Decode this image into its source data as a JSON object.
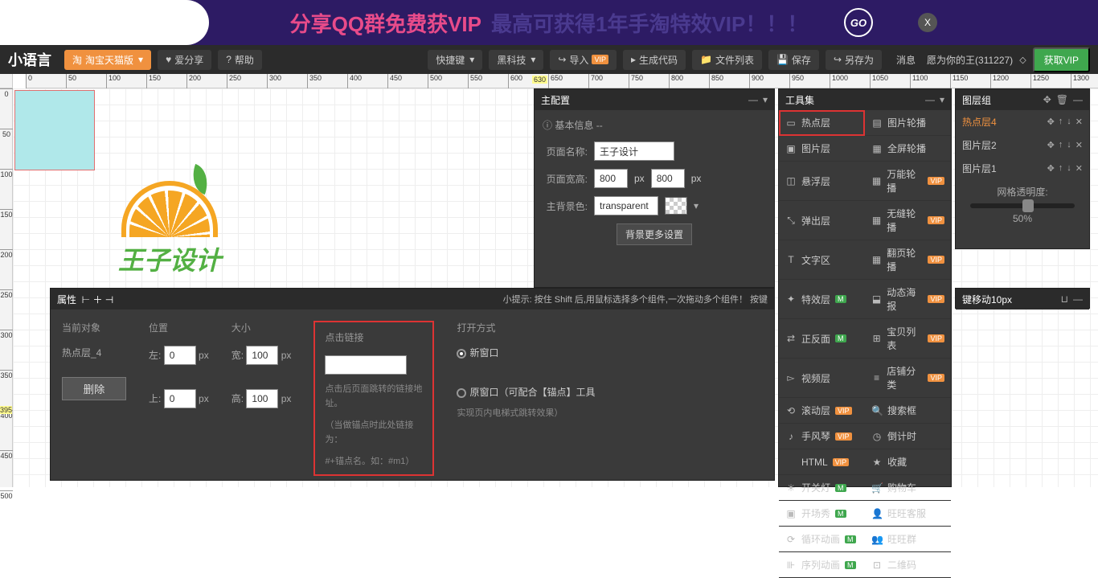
{
  "banner": {
    "text1": "分享QQ群免费获VIP",
    "text2": "最高可获得1年手淘特效VIP！！！",
    "go": "GO",
    "close": "X"
  },
  "toolbar": {
    "logo": "小语言",
    "edition": "淘宝天猫版",
    "share": "爱分享",
    "help": "帮助",
    "shortcut": "快捷键",
    "blacktech": "黑科技",
    "import": "导入",
    "gencode": "生成代码",
    "filelist": "文件列表",
    "save": "保存",
    "saveas": "另存为",
    "msg": "消息",
    "user": "愿为你的王(311227)",
    "getvip": "获取VIP",
    "vip_tag": "VIP"
  },
  "ruler": {
    "hl_h": "630",
    "hl_v": "395"
  },
  "canvas_logo": "王子设计",
  "mainConfig": {
    "title": "主配置",
    "basicInfo": "基本信息 --",
    "pageName_lbl": "页面名称:",
    "pageName_val": "王子设计",
    "pageSize_lbl": "页面宽高:",
    "w": "800",
    "h": "800",
    "px": "px",
    "bg_lbl": "主背景色:",
    "bg_val": "transparent",
    "bg_more": "背景更多设置"
  },
  "toolset": {
    "title": "工具集",
    "items": [
      {
        "icon": "▭",
        "name": "热点层",
        "hl": true
      },
      {
        "icon": "▤",
        "name": "图片轮播"
      },
      {
        "icon": "▣",
        "name": "图片层"
      },
      {
        "icon": "▦",
        "name": "全屏轮播"
      },
      {
        "icon": "◫",
        "name": "悬浮层"
      },
      {
        "icon": "▦",
        "name": "万能轮播",
        "tag": "vip"
      },
      {
        "icon": "⤡",
        "name": "弹出层"
      },
      {
        "icon": "▦",
        "name": "无缝轮播",
        "tag": "vip"
      },
      {
        "icon": "T",
        "name": "文字区"
      },
      {
        "icon": "▦",
        "name": "翻页轮播",
        "tag": "vip"
      },
      {
        "icon": "✦",
        "name": "特效层",
        "tag": "m"
      },
      {
        "icon": "⬓",
        "name": "动态海报",
        "tag": "vip"
      },
      {
        "icon": "⇄",
        "name": "正反面",
        "tag": "m"
      },
      {
        "icon": "⊞",
        "name": "宝贝列表",
        "tag": "vip"
      },
      {
        "icon": "▻",
        "name": "视频层"
      },
      {
        "icon": "≡",
        "name": "店铺分类",
        "tag": "vip"
      },
      {
        "icon": "⟲",
        "name": "滚动层",
        "tag": "vip"
      },
      {
        "icon": "🔍",
        "name": "搜索框"
      },
      {
        "icon": "♪",
        "name": "手风琴",
        "tag": "vip"
      },
      {
        "icon": "◷",
        "name": "倒计时"
      },
      {
        "icon": "</>",
        "name": "HTML",
        "tag": "vip"
      },
      {
        "icon": "★",
        "name": "收藏"
      },
      {
        "icon": "☀",
        "name": "开关灯",
        "tag": "m"
      },
      {
        "icon": "🛒",
        "name": "购物车"
      },
      {
        "icon": "▣",
        "name": "开场秀",
        "tag": "m"
      },
      {
        "icon": "👤",
        "name": "旺旺客服"
      },
      {
        "icon": "⟳",
        "name": "循环动画",
        "tag": "m"
      },
      {
        "icon": "👥",
        "name": "旺旺群"
      },
      {
        "icon": "⊪",
        "name": "序列动画",
        "tag": "m"
      },
      {
        "icon": "⊡",
        "name": "二维码"
      }
    ]
  },
  "layers": {
    "title": "图层组",
    "items": [
      {
        "name": "热点层4",
        "active": true
      },
      {
        "name": "图片层2"
      },
      {
        "name": "图片层1"
      }
    ],
    "opacity_lbl": "网格透明度:",
    "opacity_val": "50%"
  },
  "moveHint": {
    "text": "键移动10px"
  },
  "props": {
    "title": "属性",
    "hint": "小提示: 按住 Shift 后,用鼠标选择多个组件,一次拖动多个组件！  按键",
    "currentObj_lbl": "当前对象",
    "currentObj_val": "热点层_4",
    "delete": "删除",
    "pos_lbl": "位置",
    "left_lbl": "左:",
    "left_val": "0",
    "top_lbl": "上:",
    "top_val": "0",
    "size_lbl": "大小",
    "w_lbl": "宽:",
    "w_val": "100",
    "h_lbl": "高:",
    "h_val": "100",
    "px": "px",
    "link_lbl": "点击链接",
    "link_val": "",
    "link_note1": "点击后页面跳转的链接地址。",
    "link_note2": "（当做锚点时此处链接为：",
    "link_note3": "#+锚点名。如：#m1）",
    "open_lbl": "打开方式",
    "open_new": "新窗口",
    "open_orig": "原窗口（可配合【锚点】工具",
    "open_orig2": "实现页内电梯式跳转效果）"
  }
}
